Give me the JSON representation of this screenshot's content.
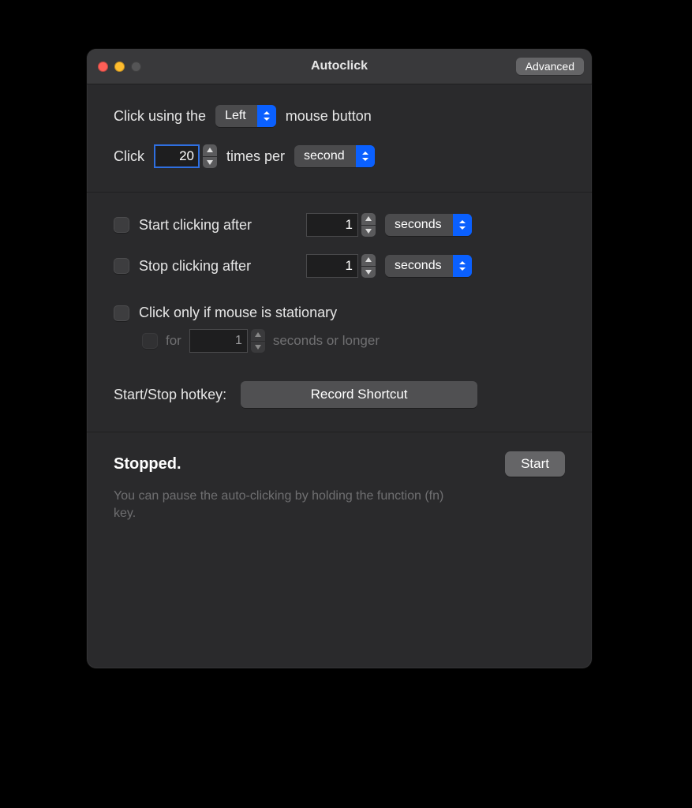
{
  "window": {
    "title": "Autoclick",
    "advanced_label": "Advanced"
  },
  "section1": {
    "text_click_using_the": "Click using the",
    "mouse_button_select": "Left",
    "text_mouse_button": "mouse button",
    "text_click": "Click",
    "click_count_value": "20",
    "text_times_per": "times per",
    "rate_unit_select": "second"
  },
  "section2": {
    "start_after_label": "Start clicking after",
    "start_after_value": "1",
    "start_after_unit": "seconds",
    "stop_after_label": "Stop clicking after",
    "stop_after_value": "1",
    "stop_after_unit": "seconds",
    "stationary_label": "Click only if mouse is stationary",
    "stationary_for_label": "for",
    "stationary_for_value": "1",
    "stationary_for_suffix": "seconds or longer",
    "hotkey_label": "Start/Stop hotkey:",
    "record_shortcut_label": "Record Shortcut"
  },
  "footer": {
    "status_text": "Stopped.",
    "start_button_label": "Start",
    "hint_text": "You can pause the auto-clicking by holding the function (fn) key."
  }
}
